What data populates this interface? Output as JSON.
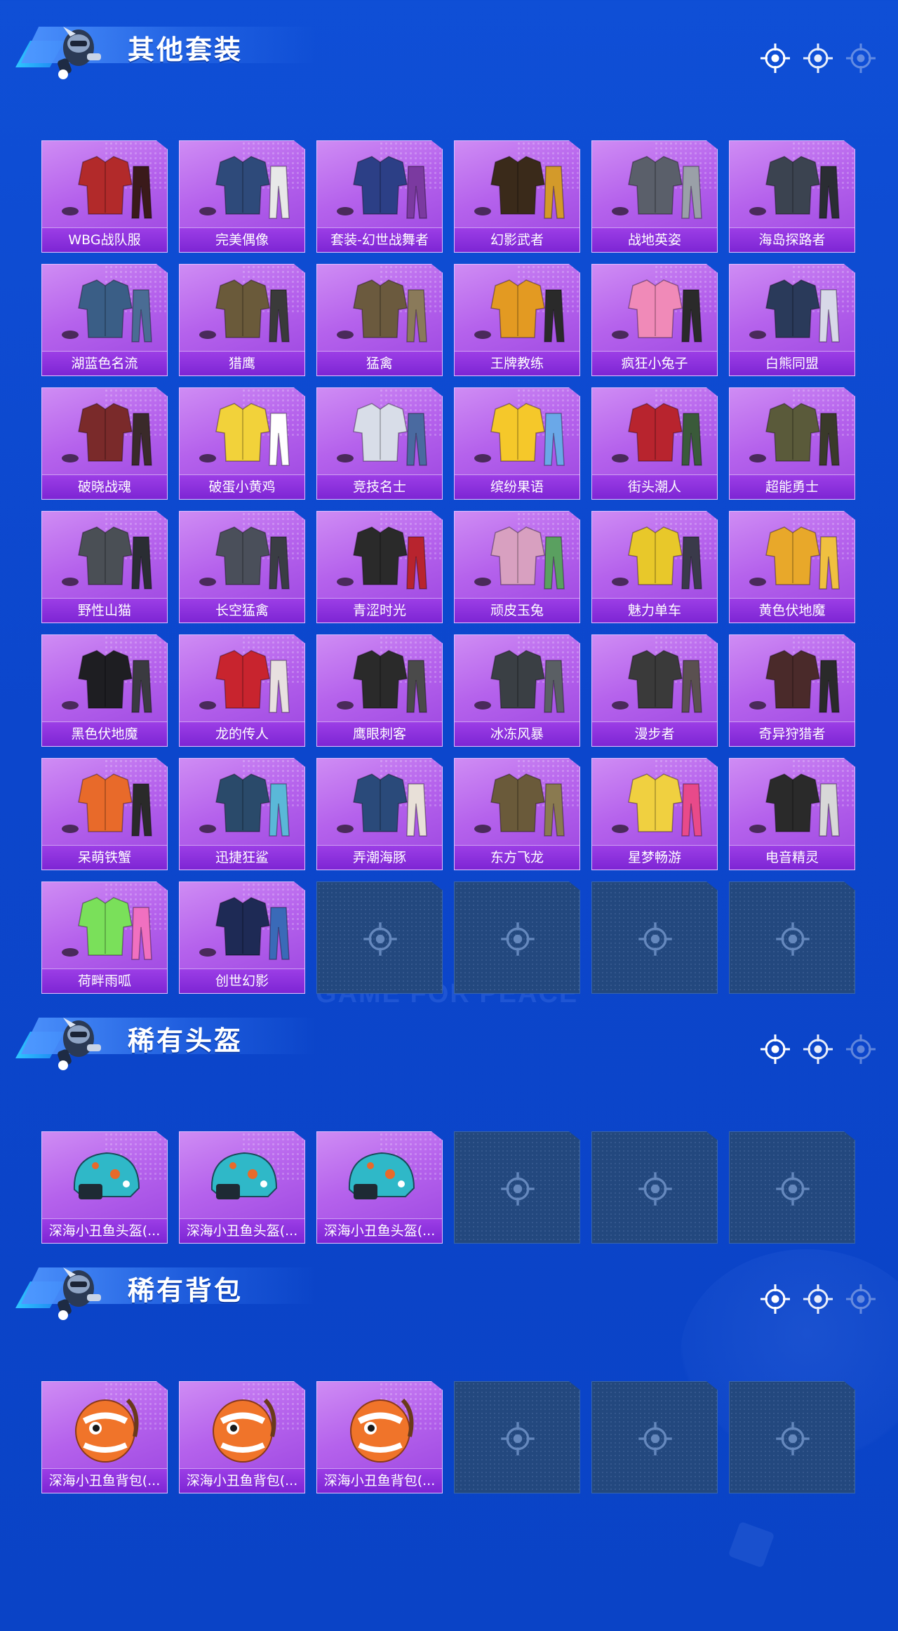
{
  "colors": {
    "background": "#0c46cc",
    "card_purple": "#b562ec",
    "card_label": "#8a30dc",
    "card_empty": "#23487e",
    "title_text": "#ffffff"
  },
  "background": {
    "logo_text": "GAME FOR PEACE"
  },
  "sections": [
    {
      "title": "其他套装",
      "header_icons": [
        "crosshair-icon",
        "crosshair-icon",
        "crosshair-icon"
      ],
      "items": [
        "WBG战队服",
        "完美偶像",
        "套装-幻世战舞者",
        "幻影武者",
        "战地英姿",
        "海岛探路者",
        "湖蓝色名流",
        "猎鹰",
        "猛禽",
        "王牌教练",
        "疯狂小兔子",
        "白熊同盟",
        "破晓战魂",
        "破蛋小黄鸡",
        "竞技名士",
        "缤纷果语",
        "街头潮人",
        "超能勇士",
        "野性山猫",
        "长空猛禽",
        "青涩时光",
        "顽皮玉兔",
        "魅力单车",
        "黄色伏地魔",
        "黑色伏地魔",
        "龙的传人",
        "鹰眼刺客",
        "冰冻风暴",
        "漫步者",
        "奇异狩猎者",
        "呆萌铁蟹",
        "迅捷狂鲨",
        "弄潮海豚",
        "东方飞龙",
        "星梦畅游",
        "电音精灵",
        "荷畔雨呱",
        "创世幻影"
      ],
      "empty_slots": 4
    },
    {
      "title": "稀有头盔",
      "header_icons": [
        "crosshair-icon",
        "crosshair-icon",
        "crosshair-icon"
      ],
      "items": [
        "深海小丑鱼头盔(...",
        "深海小丑鱼头盔(...",
        "深海小丑鱼头盔(..."
      ],
      "empty_slots": 3
    },
    {
      "title": "稀有背包",
      "header_icons": [
        "crosshair-icon",
        "crosshair-icon",
        "crosshair-icon"
      ],
      "items": [
        "深海小丑鱼背包(...",
        "深海小丑鱼背包(...",
        "深海小丑鱼背包(..."
      ],
      "empty_slots": 3
    }
  ]
}
